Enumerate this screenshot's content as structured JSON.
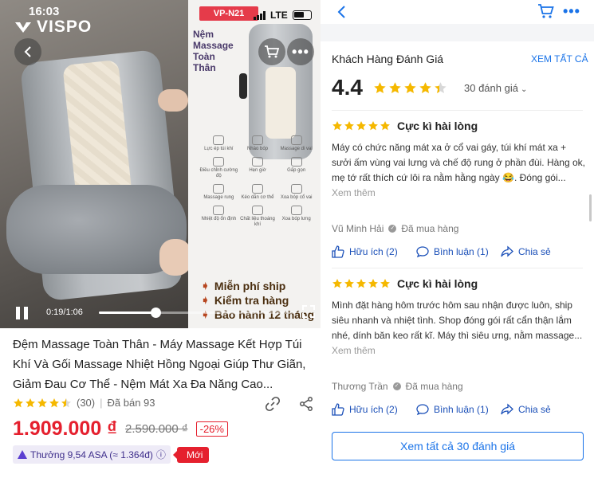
{
  "status_bar": {
    "time": "16:03",
    "network": "LTE"
  },
  "brand": {
    "name": "VISPO"
  },
  "ad": {
    "model_badge": "VP-N21",
    "title": "Nệm\nMassage\nToàn\nThân",
    "features": [
      {
        "label": "Lực ép túi khí",
        "icon": "airbag-icon"
      },
      {
        "label": "Nhào bóp",
        "icon": "knead-icon"
      },
      {
        "label": "Massage di vai",
        "icon": "shoulder-icon"
      },
      {
        "label": "Điều chỉnh cường độ",
        "icon": "intensity-icon"
      },
      {
        "label": "Hẹn giờ",
        "icon": "timer-icon"
      },
      {
        "label": "Gấp gọn",
        "icon": "fold-icon"
      },
      {
        "label": "Massage rung",
        "icon": "vibration-icon"
      },
      {
        "label": "Kéo dãn cơ thể",
        "icon": "stretch-icon"
      },
      {
        "label": "Xoa bóp cổ vai",
        "icon": "neck-icon"
      },
      {
        "label": "Nhiệt độ ổn định",
        "icon": "heat-icon"
      },
      {
        "label": "Chất liệu thoáng khí",
        "icon": "fabric-icon"
      },
      {
        "label": "Xoa bóp lưng",
        "icon": "back-icon"
      }
    ],
    "benefits": [
      "Miễn phí ship",
      "Kiểm tra hàng",
      "Bảo hành 12 tháng"
    ]
  },
  "video": {
    "time": "0:19/1:06",
    "progress": 0.29
  },
  "product": {
    "title": "Đệm Massage Toàn Thân - Máy Massage Kết Hợp Túi Khí Và Gối Massage Nhiệt Hồng Ngoại Giúp Thư Giãn, Giảm Đau Cơ Thể - Nệm Mát Xa Đa Năng Cao...",
    "rating_count": "(30)",
    "sold": "Đã bán 93",
    "price": "1.909.000 ₫",
    "old_price": "2.590.000 ₫",
    "discount": "-26%",
    "reward": "Thưởng 9,54 ASA (≈ 1.364đ)",
    "new_badge": "Mới",
    "rating_stars": 4.5
  },
  "reviews_section": {
    "title": "Khách Hàng Đánh Giá",
    "see_all_link": "XEM TẤT CẢ",
    "average": "4.4",
    "average_stars": 4.4,
    "count_label": "30 đánh giá",
    "see_all_button": "Xem tất cả 30 đánh giá",
    "reviews": [
      {
        "stars": 5,
        "title": "Cực kì hài lòng",
        "body": "Máy có chức năng mát xa ở cổ vai gáy, túi khí mát xa + sưởi ấm vùng vai lưng và chế độ rung ở phần đùi. Hàng ok, mẹ tớ rất thích cứ lôi ra nằm hằng ngày 😂. Đóng gói...",
        "more": "Xem thêm",
        "user": "Vũ Minh Hải",
        "purchased": "Đã mua hàng",
        "helpful": "Hữu ích (2)",
        "comment": "Bình luận (1)",
        "share": "Chia sẻ"
      },
      {
        "stars": 5,
        "title": "Cực kì hài lòng",
        "body": "Mình đặt hàng hôm trước hôm sau nhận được luôn, ship siêu nhanh và nhiệt tình. Shop đóng gói rất cẩn thận lắm nhé, dính băn keo rất kĩ. Máy thì siêu ưng, nằm massage...",
        "more": "Xem thêm",
        "user": "Thương Trần",
        "purchased": "Đã mua hàng",
        "helpful": "Hữu ích (2)",
        "comment": "Bình luận (1)",
        "share": "Chia sẻ"
      }
    ]
  },
  "colors": {
    "price": "#e5202e",
    "link": "#1a73e8",
    "star": "#f5b800",
    "reward": "#3f2f8c"
  }
}
